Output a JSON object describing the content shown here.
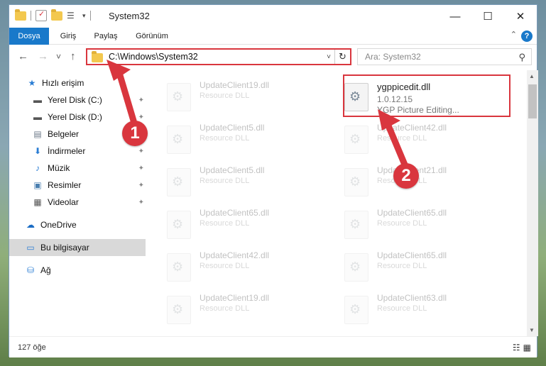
{
  "window": {
    "title": "System32",
    "minimize_glyph": "—",
    "maximize_glyph": "☐",
    "close_glyph": "✕"
  },
  "ribbon": {
    "tabs": [
      "Dosya",
      "Giriş",
      "Paylaş",
      "Görünüm"
    ],
    "active_tab": "Dosya",
    "help_glyph": "?",
    "collapse_glyph": "⌃",
    "accent": "#1979ca"
  },
  "nav": {
    "back_glyph": "←",
    "forward_glyph": "→",
    "recent_glyph": "˅",
    "up_glyph": "↑",
    "address": "C:\\Windows\\System32",
    "address_dropdown_glyph": "˅",
    "refresh_glyph": "↻",
    "search_placeholder": "Ara: System32",
    "search_icon_glyph": "⚲"
  },
  "sidebar": {
    "items": [
      {
        "label": "Hızlı erişim",
        "icon": "star-icon",
        "glyph": "★",
        "pinned": false,
        "selected": false
      },
      {
        "label": "Yerel Disk (C:)",
        "icon": "drive-icon",
        "glyph": "▬",
        "pinned": true,
        "selected": false
      },
      {
        "label": "Yerel Disk (D:)",
        "icon": "drive-icon",
        "glyph": "▬",
        "pinned": true,
        "selected": false
      },
      {
        "label": "Belgeler",
        "icon": "documents-icon",
        "glyph": "▤",
        "pinned": true,
        "selected": false
      },
      {
        "label": "İndirmeler",
        "icon": "download-icon",
        "glyph": "⬇",
        "pinned": true,
        "selected": false
      },
      {
        "label": "Müzik",
        "icon": "music-icon",
        "glyph": "♪",
        "pinned": true,
        "selected": false
      },
      {
        "label": "Resimler",
        "icon": "pictures-icon",
        "glyph": "▣",
        "pinned": true,
        "selected": false
      },
      {
        "label": "Videolar",
        "icon": "videos-icon",
        "glyph": "▦",
        "pinned": true,
        "selected": false
      },
      {
        "label": "OneDrive",
        "icon": "cloud-icon",
        "glyph": "☁",
        "pinned": false,
        "selected": false
      },
      {
        "label": "Bu bilgisayar",
        "icon": "computer-icon",
        "glyph": "▭",
        "pinned": false,
        "selected": true
      },
      {
        "label": "Ağ",
        "icon": "network-icon",
        "glyph": "⛁",
        "pinned": false,
        "selected": false
      }
    ],
    "pin_glyph": "📌"
  },
  "files": {
    "left_column": [
      {
        "name": "UpdateClient19.dll",
        "desc": "Resource DLL"
      },
      {
        "name": "UpdateClient5.dll",
        "desc": "Resource DLL"
      },
      {
        "name": "UpdateClient5.dll",
        "desc": "Resource DLL"
      },
      {
        "name": "UpdateClient65.dll",
        "desc": "Resource DLL"
      },
      {
        "name": "UpdateClient42.dll",
        "desc": "Resource DLL"
      },
      {
        "name": "UpdateClient19.dll",
        "desc": "Resource DLL"
      }
    ],
    "right_column": [
      {
        "name": "UpdateClient42.dll",
        "desc": "Resource DLL"
      },
      {
        "name": "UpdateClient21.dll",
        "desc": "Resource DLL"
      },
      {
        "name": "UpdateClient65.dll",
        "desc": "Resource DLL"
      },
      {
        "name": "UpdateClient65.dll",
        "desc": "Resource DLL"
      },
      {
        "name": "UpdateClient63.dll",
        "desc": "Resource DLL"
      }
    ],
    "highlighted": {
      "name": "ygppicedit.dll",
      "version": "1.0.12.15",
      "desc": "YGP Picture Editing..."
    }
  },
  "status": {
    "item_count": "127 öğe",
    "details_view_glyph": "☷",
    "tiles_view_glyph": "▦"
  },
  "annotations": {
    "badge1": "1",
    "badge2": "2",
    "color": "#d9363e"
  }
}
